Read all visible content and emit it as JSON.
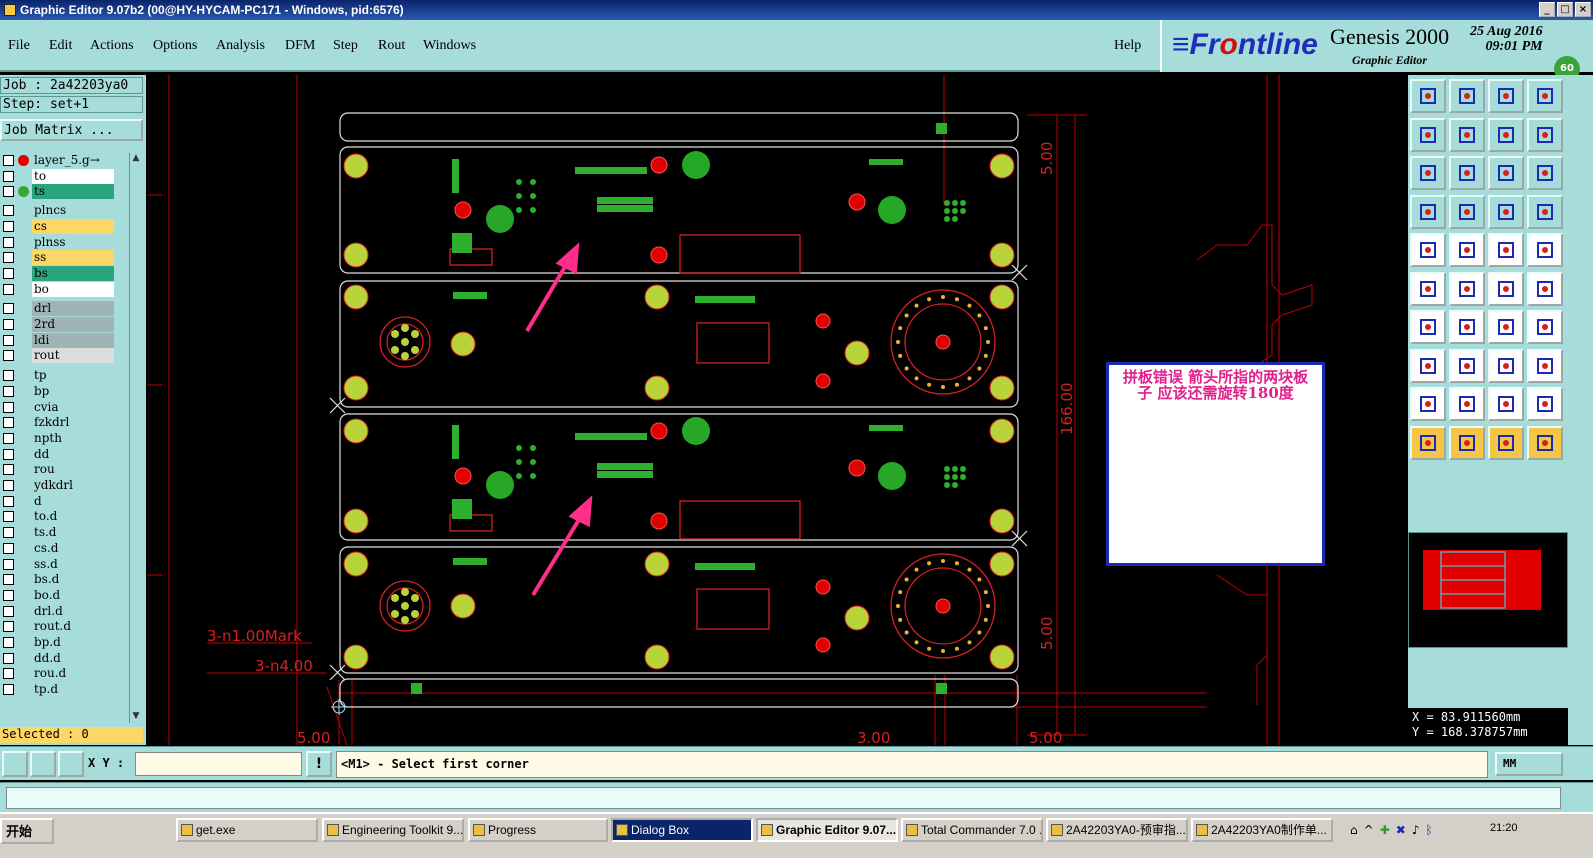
{
  "window": {
    "title": "Graphic Editor 9.07b2 (00@HY-HYCAM-PC171 - Windows, pid:6576)"
  },
  "menu": [
    "File",
    "Edit",
    "Actions",
    "Options",
    "Analysis",
    "DFM",
    "Step",
    "Rout",
    "Windows"
  ],
  "help": "Help",
  "brand": {
    "logo_a": "≡Fr",
    "logo_b": "o",
    "logo_c": "ntline",
    "product": "Genesis 2000",
    "sub": "Graphic Editor",
    "date": "25 Aug 2016",
    "time": "09:01 PM",
    "badge": "60"
  },
  "left": {
    "job": "Job : 2a42203ya0",
    "step": "Step: set+1",
    "job_matrix": "Job Matrix ...",
    "layers": [
      {
        "name": "layer_5.g→",
        "bg": "#a6dcd9",
        "dot": "#e00000"
      },
      {
        "name": "to",
        "bg": "#ffffff"
      },
      {
        "name": "ts",
        "bg": "#28a47e",
        "dot": "#3aa33a"
      },
      {
        "name": "plncs",
        "bg": "#a6dcd9"
      },
      {
        "name": "cs",
        "bg": "#fcd666"
      },
      {
        "name": "plnss",
        "bg": "#a6dcd9"
      },
      {
        "name": "ss",
        "bg": "#fcd666"
      },
      {
        "name": "bs",
        "bg": "#28a47e"
      },
      {
        "name": "bo",
        "bg": "#ffffff"
      },
      {
        "name": "drl",
        "bg": "#a0b4b8"
      },
      {
        "name": "2rd",
        "bg": "#a0b4b8"
      },
      {
        "name": "ldi",
        "bg": "#a0b4b8"
      },
      {
        "name": "rout",
        "bg": "#dddddd"
      },
      {
        "name": "tp",
        "bg": "#a6dcd9"
      },
      {
        "name": "bp",
        "bg": "#a6dcd9"
      },
      {
        "name": "cvia",
        "bg": "#a6dcd9"
      },
      {
        "name": "fzkdrl",
        "bg": "#a6dcd9"
      },
      {
        "name": "npth",
        "bg": "#a6dcd9"
      },
      {
        "name": "dd",
        "bg": "#a6dcd9"
      },
      {
        "name": "rou",
        "bg": "#a6dcd9"
      },
      {
        "name": "ydkdrl",
        "bg": "#a6dcd9"
      },
      {
        "name": "d",
        "bg": "#a6dcd9"
      },
      {
        "name": "to.d",
        "bg": "#a6dcd9"
      },
      {
        "name": "ts.d",
        "bg": "#a6dcd9"
      },
      {
        "name": "cs.d",
        "bg": "#a6dcd9"
      },
      {
        "name": "ss.d",
        "bg": "#a6dcd9"
      },
      {
        "name": "bs.d",
        "bg": "#a6dcd9"
      },
      {
        "name": "bo.d",
        "bg": "#a6dcd9"
      },
      {
        "name": "drl.d",
        "bg": "#a6dcd9"
      },
      {
        "name": "rout.d",
        "bg": "#a6dcd9"
      },
      {
        "name": "bp.d",
        "bg": "#a6dcd9"
      },
      {
        "name": "dd.d",
        "bg": "#a6dcd9"
      },
      {
        "name": "rou.d",
        "bg": "#a6dcd9"
      },
      {
        "name": "tp.d",
        "bg": "#a6dcd9"
      }
    ],
    "selected": "Selected : 0"
  },
  "canvas": {
    "dims": {
      "top": "5.00",
      "mid": "166.00",
      "bottom": "5.00",
      "b1": "3.00",
      "b2": "5.00",
      "left": "5.00"
    },
    "mark1": "3-n1.00Mark",
    "mark2": "3-n4.00"
  },
  "annotation": {
    "line1": "拼板错误  箭头所指的两块板子 应该还需旋转180度"
  },
  "coords": {
    "x": "X = 83.911560mm",
    "y": "Y = 168.378757mm"
  },
  "command": {
    "xy_label": "X Y :",
    "xy_value": "",
    "message": "<M1> - Select first corner",
    "units": "MM"
  },
  "taskbar": {
    "start": "开始",
    "tasks": [
      {
        "label": "get.exe"
      },
      {
        "label": "Engineering Toolkit 9...."
      },
      {
        "label": "Progress"
      },
      {
        "label": "Dialog Box"
      },
      {
        "label": "Graphic Editor 9.07..."
      },
      {
        "label": "Total Commander 7.0 ..."
      },
      {
        "label": "2A42203YA0-预审指..."
      },
      {
        "label": "2A42203YA0制作单..."
      }
    ],
    "clock": "21:20"
  }
}
